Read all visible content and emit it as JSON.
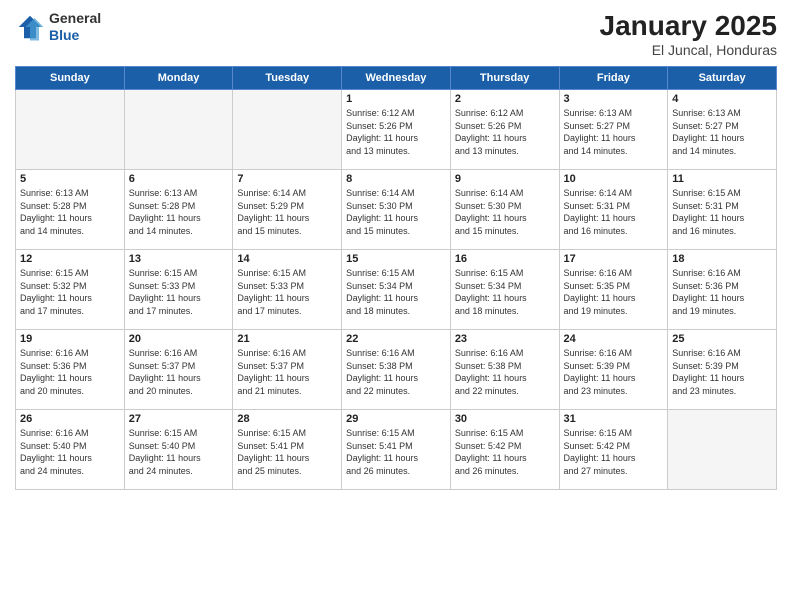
{
  "header": {
    "logo_general": "General",
    "logo_blue": "Blue",
    "month_title": "January 2025",
    "location": "El Juncal, Honduras"
  },
  "weekdays": [
    "Sunday",
    "Monday",
    "Tuesday",
    "Wednesday",
    "Thursday",
    "Friday",
    "Saturday"
  ],
  "weeks": [
    [
      {
        "day": "",
        "info": ""
      },
      {
        "day": "",
        "info": ""
      },
      {
        "day": "",
        "info": ""
      },
      {
        "day": "1",
        "info": "Sunrise: 6:12 AM\nSunset: 5:26 PM\nDaylight: 11 hours\nand 13 minutes."
      },
      {
        "day": "2",
        "info": "Sunrise: 6:12 AM\nSunset: 5:26 PM\nDaylight: 11 hours\nand 13 minutes."
      },
      {
        "day": "3",
        "info": "Sunrise: 6:13 AM\nSunset: 5:27 PM\nDaylight: 11 hours\nand 14 minutes."
      },
      {
        "day": "4",
        "info": "Sunrise: 6:13 AM\nSunset: 5:27 PM\nDaylight: 11 hours\nand 14 minutes."
      }
    ],
    [
      {
        "day": "5",
        "info": "Sunrise: 6:13 AM\nSunset: 5:28 PM\nDaylight: 11 hours\nand 14 minutes."
      },
      {
        "day": "6",
        "info": "Sunrise: 6:13 AM\nSunset: 5:28 PM\nDaylight: 11 hours\nand 14 minutes."
      },
      {
        "day": "7",
        "info": "Sunrise: 6:14 AM\nSunset: 5:29 PM\nDaylight: 11 hours\nand 15 minutes."
      },
      {
        "day": "8",
        "info": "Sunrise: 6:14 AM\nSunset: 5:30 PM\nDaylight: 11 hours\nand 15 minutes."
      },
      {
        "day": "9",
        "info": "Sunrise: 6:14 AM\nSunset: 5:30 PM\nDaylight: 11 hours\nand 15 minutes."
      },
      {
        "day": "10",
        "info": "Sunrise: 6:14 AM\nSunset: 5:31 PM\nDaylight: 11 hours\nand 16 minutes."
      },
      {
        "day": "11",
        "info": "Sunrise: 6:15 AM\nSunset: 5:31 PM\nDaylight: 11 hours\nand 16 minutes."
      }
    ],
    [
      {
        "day": "12",
        "info": "Sunrise: 6:15 AM\nSunset: 5:32 PM\nDaylight: 11 hours\nand 17 minutes."
      },
      {
        "day": "13",
        "info": "Sunrise: 6:15 AM\nSunset: 5:33 PM\nDaylight: 11 hours\nand 17 minutes."
      },
      {
        "day": "14",
        "info": "Sunrise: 6:15 AM\nSunset: 5:33 PM\nDaylight: 11 hours\nand 17 minutes."
      },
      {
        "day": "15",
        "info": "Sunrise: 6:15 AM\nSunset: 5:34 PM\nDaylight: 11 hours\nand 18 minutes."
      },
      {
        "day": "16",
        "info": "Sunrise: 6:15 AM\nSunset: 5:34 PM\nDaylight: 11 hours\nand 18 minutes."
      },
      {
        "day": "17",
        "info": "Sunrise: 6:16 AM\nSunset: 5:35 PM\nDaylight: 11 hours\nand 19 minutes."
      },
      {
        "day": "18",
        "info": "Sunrise: 6:16 AM\nSunset: 5:36 PM\nDaylight: 11 hours\nand 19 minutes."
      }
    ],
    [
      {
        "day": "19",
        "info": "Sunrise: 6:16 AM\nSunset: 5:36 PM\nDaylight: 11 hours\nand 20 minutes."
      },
      {
        "day": "20",
        "info": "Sunrise: 6:16 AM\nSunset: 5:37 PM\nDaylight: 11 hours\nand 20 minutes."
      },
      {
        "day": "21",
        "info": "Sunrise: 6:16 AM\nSunset: 5:37 PM\nDaylight: 11 hours\nand 21 minutes."
      },
      {
        "day": "22",
        "info": "Sunrise: 6:16 AM\nSunset: 5:38 PM\nDaylight: 11 hours\nand 22 minutes."
      },
      {
        "day": "23",
        "info": "Sunrise: 6:16 AM\nSunset: 5:38 PM\nDaylight: 11 hours\nand 22 minutes."
      },
      {
        "day": "24",
        "info": "Sunrise: 6:16 AM\nSunset: 5:39 PM\nDaylight: 11 hours\nand 23 minutes."
      },
      {
        "day": "25",
        "info": "Sunrise: 6:16 AM\nSunset: 5:39 PM\nDaylight: 11 hours\nand 23 minutes."
      }
    ],
    [
      {
        "day": "26",
        "info": "Sunrise: 6:16 AM\nSunset: 5:40 PM\nDaylight: 11 hours\nand 24 minutes."
      },
      {
        "day": "27",
        "info": "Sunrise: 6:15 AM\nSunset: 5:40 PM\nDaylight: 11 hours\nand 24 minutes."
      },
      {
        "day": "28",
        "info": "Sunrise: 6:15 AM\nSunset: 5:41 PM\nDaylight: 11 hours\nand 25 minutes."
      },
      {
        "day": "29",
        "info": "Sunrise: 6:15 AM\nSunset: 5:41 PM\nDaylight: 11 hours\nand 26 minutes."
      },
      {
        "day": "30",
        "info": "Sunrise: 6:15 AM\nSunset: 5:42 PM\nDaylight: 11 hours\nand 26 minutes."
      },
      {
        "day": "31",
        "info": "Sunrise: 6:15 AM\nSunset: 5:42 PM\nDaylight: 11 hours\nand 27 minutes."
      },
      {
        "day": "",
        "info": ""
      }
    ]
  ]
}
